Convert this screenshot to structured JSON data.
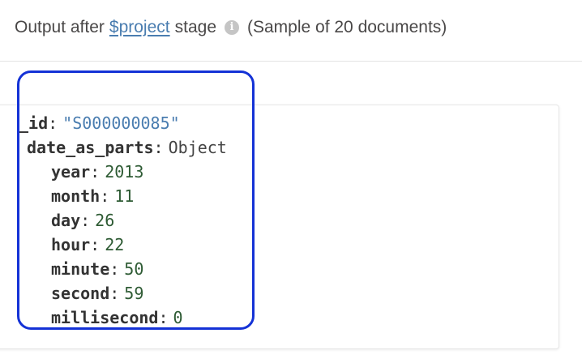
{
  "header": {
    "prefix": "Output after",
    "stage_link": "$project",
    "suffix": "stage",
    "info_icon": "info-circle-icon",
    "sample_text": "(Sample of 20 documents)"
  },
  "document": {
    "id_key": "_id",
    "id_value": "\"S000000085\"",
    "object_key": "date_as_parts",
    "object_type": "Object",
    "fields": [
      {
        "key": "year",
        "value": "2013"
      },
      {
        "key": "month",
        "value": "11"
      },
      {
        "key": "day",
        "value": "26"
      },
      {
        "key": "hour",
        "value": "22"
      },
      {
        "key": "minute",
        "value": "50"
      },
      {
        "key": "second",
        "value": "59"
      },
      {
        "key": "millisecond",
        "value": "0"
      }
    ]
  },
  "colors": {
    "link": "#4a7db0",
    "number": "#2e5b34",
    "highlight": "#1432d6"
  }
}
